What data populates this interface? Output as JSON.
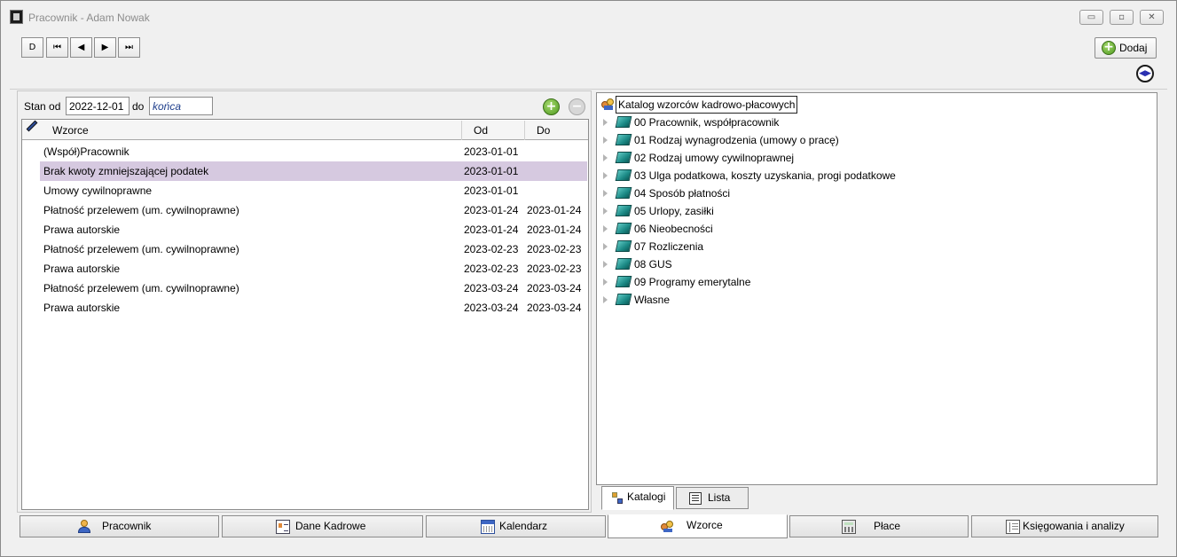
{
  "window": {
    "title": "Pracownik - Adam Nowak",
    "controls": {
      "minimize": "▭",
      "maximize": "▫",
      "close": "✕"
    }
  },
  "toolbar": {
    "nav": {
      "new": "D",
      "first": "⏮",
      "prev": "◀",
      "next": "▶",
      "last": "⏭"
    },
    "add_label": "Dodaj",
    "add_icon": "plus-circle-icon",
    "toggle_icon": "◀▶"
  },
  "filter": {
    "stan_od_label": "Stan od",
    "date_from": "2022-12-01",
    "do_label": "do",
    "date_to": "końca"
  },
  "templates_table": {
    "columns": [
      "Wzorce",
      "Od",
      "Do"
    ],
    "rows": [
      {
        "name": "(Współ)Pracownik",
        "od": "2023-01-01",
        "do": ""
      },
      {
        "name": "Brak kwoty zmniejszającej podatek",
        "od": "2023-01-01",
        "do": "",
        "selected": true
      },
      {
        "name": "Umowy cywilnoprawne",
        "od": "2023-01-01",
        "do": ""
      },
      {
        "name": "Płatność przelewem (um. cywilnoprawne)",
        "od": "2023-01-24",
        "do": "2023-01-24"
      },
      {
        "name": "Prawa autorskie",
        "od": "2023-01-24",
        "do": "2023-01-24"
      },
      {
        "name": "Płatność przelewem (um. cywilnoprawne)",
        "od": "2023-02-23",
        "do": "2023-02-23"
      },
      {
        "name": "Prawa autorskie",
        "od": "2023-02-23",
        "do": "2023-02-23"
      },
      {
        "name": "Płatność przelewem (um. cywilnoprawne)",
        "od": "2023-03-24",
        "do": "2023-03-24"
      },
      {
        "name": "Prawa autorskie",
        "od": "2023-03-24",
        "do": "2023-03-24"
      }
    ]
  },
  "catalog_tree": {
    "root": "Katalog wzorców kadrowo-płacowych",
    "items": [
      "00 Pracownik, współpracownik",
      "01 Rodzaj wynagrodzenia (umowy o pracę)",
      "02 Rodzaj umowy cywilnoprawnej",
      "03 Ulga podatkowa, koszty uzyskania, progi podatkowe",
      "04 Sposób płatności",
      "05 Urlopy, zasiłki",
      "06 Nieobecności",
      "07 Rozliczenia",
      "08 GUS",
      "09 Programy emerytalne",
      "Własne"
    ]
  },
  "sub_tabs": [
    "Katalogi",
    "Lista"
  ],
  "bottom_tabs": [
    {
      "label": "Pracownik",
      "icon": "person-icon"
    },
    {
      "label": "Dane Kadrowe",
      "icon": "id-card-icon"
    },
    {
      "label": "Kalendarz",
      "icon": "calendar-icon"
    },
    {
      "label": "Wzorce",
      "icon": "people-icon",
      "active": true
    },
    {
      "label": "Płace",
      "icon": "calculator-icon"
    },
    {
      "label": "Księgowania i analizy",
      "icon": "ledger-icon"
    }
  ]
}
